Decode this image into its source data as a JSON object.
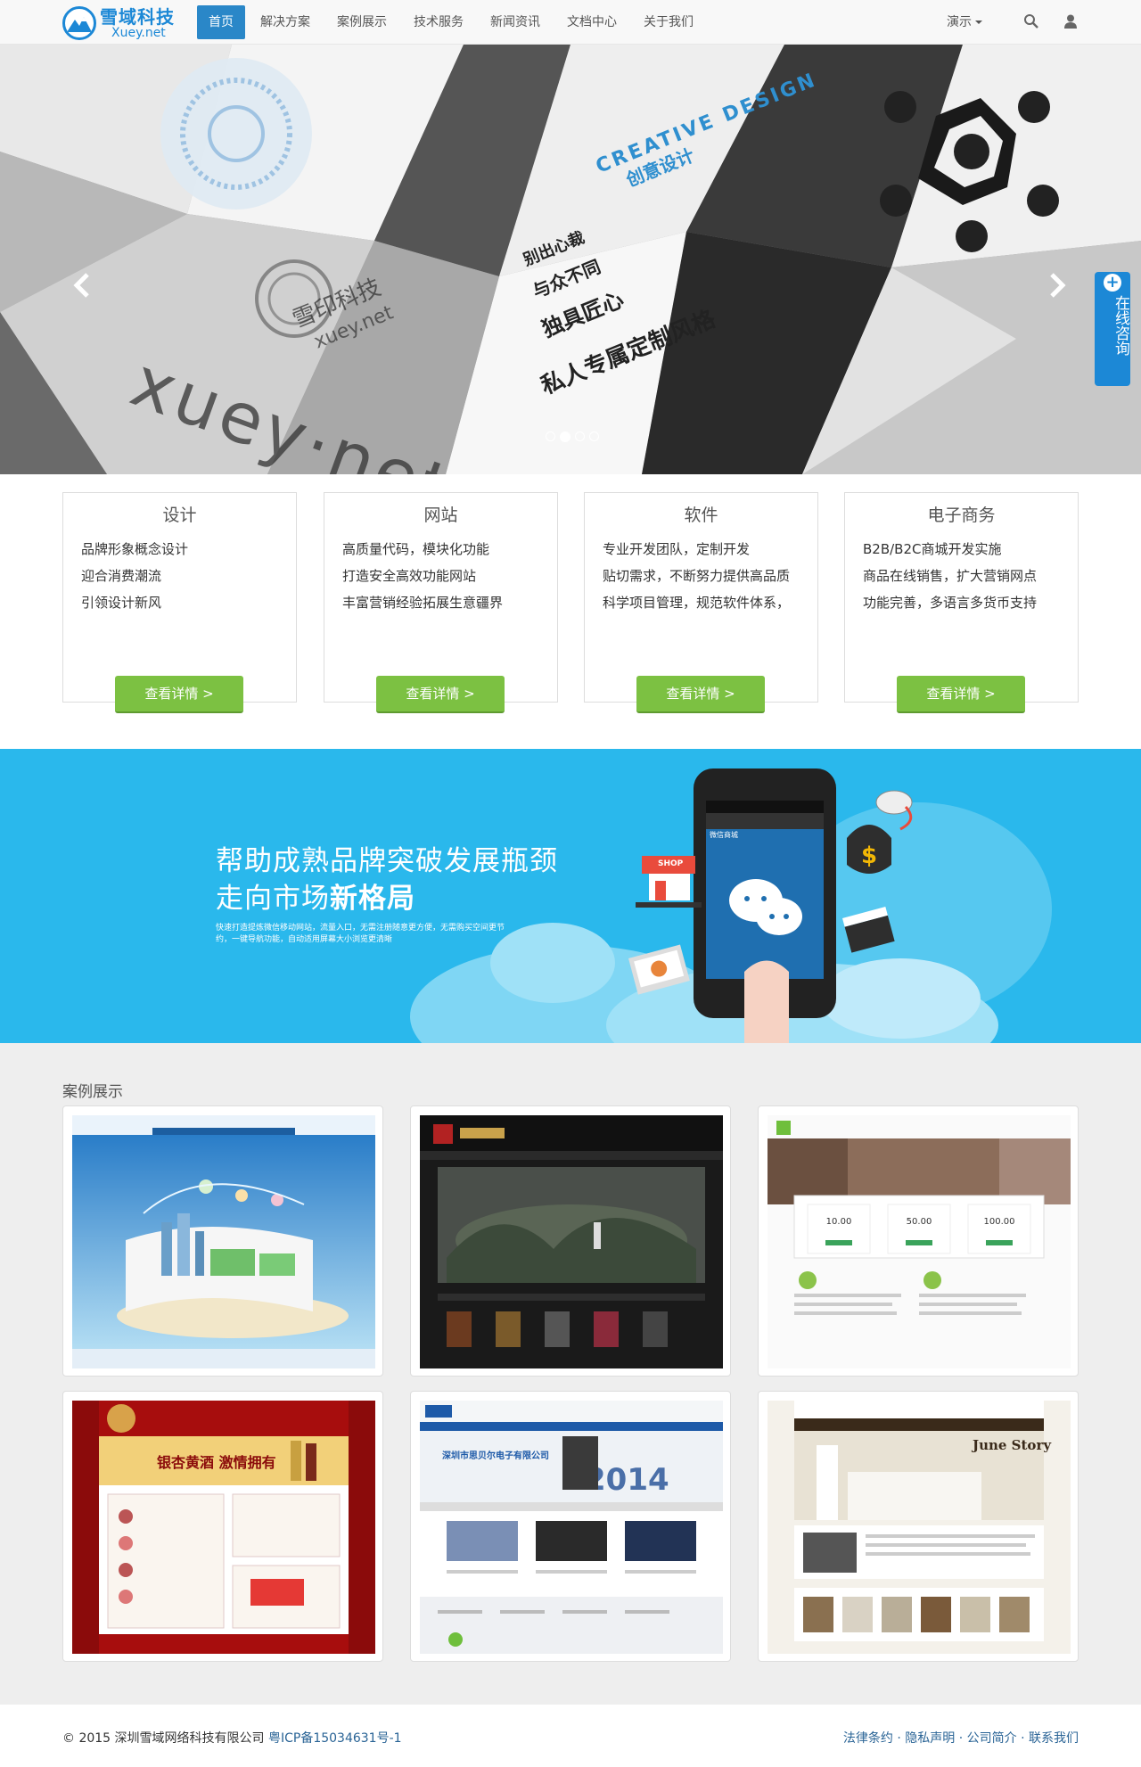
{
  "brand": {
    "name_cn": "雪域科技",
    "name_en": "Xuey.net",
    "accent": "#1c88d6"
  },
  "nav": {
    "items": [
      {
        "label": "首页",
        "active": true
      },
      {
        "label": "解决方案"
      },
      {
        "label": "案例展示"
      },
      {
        "label": "技术服务"
      },
      {
        "label": "新闻资讯"
      },
      {
        "label": "文档中心"
      },
      {
        "label": "关于我们"
      }
    ],
    "demo_label": "演示",
    "icons": [
      "search-icon",
      "user-icon"
    ]
  },
  "hero": {
    "english_watermark": "xuey·net",
    "stamp_text": "雪印科技",
    "stamp_en": "xuey.net",
    "creative_en": "CREATIVE DESIGN",
    "creative_cn": "创意设计",
    "slogans": [
      "别出心裁",
      "与众不同",
      "独具匠心",
      "私人专属定制风格"
    ],
    "slide_count": 4,
    "active_slide": 2
  },
  "consult": {
    "label": "在线咨询"
  },
  "services": [
    {
      "title": "设计",
      "lines": [
        "品牌形象概念设计",
        "迎合消费潮流",
        "引领设计新风"
      ],
      "button": "查看详情 >"
    },
    {
      "title": "网站",
      "lines": [
        "高质量代码，模块化功能",
        "打造安全高效功能网站",
        "丰富营销经验拓展生意疆界"
      ],
      "button": "查看详情 >"
    },
    {
      "title": "软件",
      "lines": [
        "专业开发团队，定制开发",
        "贴切需求，不断努力提供高品质",
        "科学项目管理，规范软件体系，"
      ],
      "button": "查看详情 >"
    },
    {
      "title": "电子商务",
      "lines": [
        "B2B/B2C商城开发实施",
        "商品在线销售，扩大营销网点",
        "功能完善，多语言多货币支持"
      ],
      "button": "查看详情 >"
    }
  ],
  "banner": {
    "line1": "帮助成熟品牌突破发展瓶颈",
    "line2_prefix": "走向市场",
    "line2_bold": "新格局",
    "desc": "快速打造提炼微信移动网站，流量入口，无需注册随意更方便，无需购买空间更节约，一键导航功能，自动适用屏幕大小浏览更清晰",
    "phone_title": "微信商城",
    "shop_sign": "SHOP"
  },
  "cases": {
    "title": "案例展示",
    "items": [
      {
        "name": "case-city"
      },
      {
        "name": "case-dark"
      },
      {
        "name": "case-pricing",
        "prices": [
          "10.00",
          "50.00",
          "100.00"
        ]
      },
      {
        "name": "case-wine",
        "headline": "银杏黄酒 激情拥有"
      },
      {
        "name": "case-electronics",
        "headline": "深圳市思贝尔电子有限公司",
        "year": "2014"
      },
      {
        "name": "case-decor",
        "headline": "June Story"
      }
    ]
  },
  "footer": {
    "copyright": "© 2015 深圳雪域网络科技有限公司",
    "icp": "粤ICP备15034631号-1",
    "links": [
      "法律条约",
      "隐私声明",
      "公司简介",
      "联系我们"
    ]
  }
}
